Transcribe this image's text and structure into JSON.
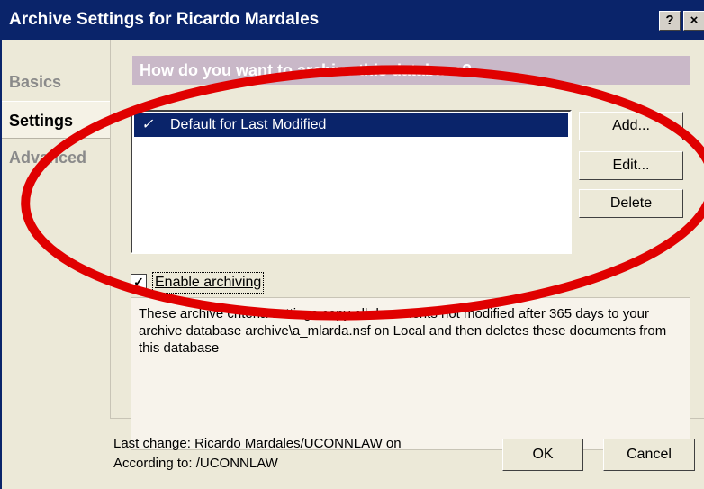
{
  "window": {
    "title": "Archive Settings for Ricardo Mardales",
    "help_button": "?",
    "close_button": "×"
  },
  "tabs": [
    {
      "label": "Basics"
    },
    {
      "label": "Settings"
    },
    {
      "label": "Advanced"
    }
  ],
  "panel": {
    "question": "How do you want to archive this database?",
    "list": {
      "items": [
        {
          "check": "✓",
          "label": "Default for Last Modified"
        }
      ]
    },
    "buttons": {
      "add": "Add...",
      "edit": "Edit...",
      "delete": "Delete"
    },
    "enable_archiving": {
      "checked": true,
      "mark": "✓",
      "label": "Enable archiving"
    },
    "description": "These archive criteria settings copy all documents not modified after 365 days to your archive database archive\\a_mlarda.nsf on Local and then deletes these documents from this database"
  },
  "footer": {
    "last_change": "Last change: Ricardo Mardales/UCONNLAW on",
    "according_to": "According to: /UCONNLAW",
    "ok": "OK",
    "cancel": "Cancel"
  },
  "colors": {
    "titlebar": "#0a246a",
    "selection": "#0a246a",
    "question_bar": "#c9b8c8",
    "annotation_oval": "#e00000"
  }
}
